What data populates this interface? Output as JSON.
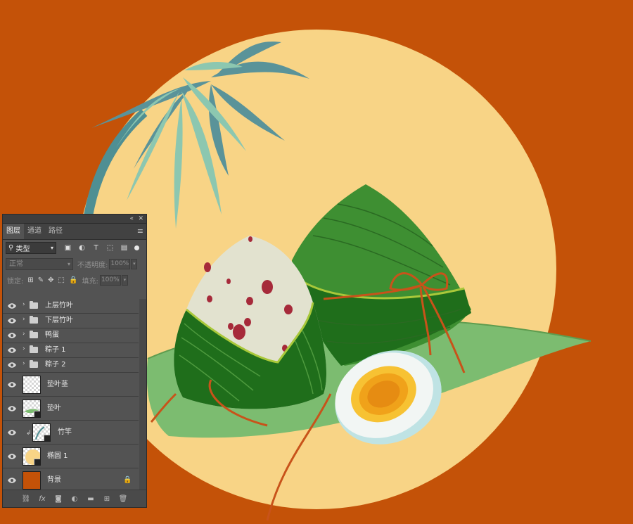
{
  "panel": {
    "collapse_icon": "double-chevron-left",
    "close_icon": "close",
    "tabs": [
      {
        "label": "图层",
        "active": true
      },
      {
        "label": "通道",
        "active": false
      },
      {
        "label": "路径",
        "active": false
      }
    ],
    "filter": {
      "label": "类型"
    },
    "blend_mode": "正常",
    "opacity_label": "不透明度:",
    "opacity_value": "100%",
    "lock_label": "锁定:",
    "fill_label": "填充:",
    "fill_value": "100%",
    "layers": [
      {
        "name": "上层竹叶",
        "kind": "group",
        "visible": true
      },
      {
        "name": "下层竹叶",
        "kind": "group",
        "visible": true
      },
      {
        "name": "鸭蛋",
        "kind": "group",
        "visible": true
      },
      {
        "name": "粽子 1",
        "kind": "group",
        "visible": true
      },
      {
        "name": "粽子 2",
        "kind": "group",
        "visible": true
      },
      {
        "name": "垫叶茎",
        "kind": "layer",
        "visible": true
      },
      {
        "name": "垫叶",
        "kind": "layer",
        "visible": true
      },
      {
        "name": "竹竿",
        "kind": "clipped-layer",
        "visible": true
      },
      {
        "name": "椭圆 1",
        "kind": "shape-layer",
        "visible": true
      },
      {
        "name": "背景",
        "kind": "background",
        "visible": true,
        "locked": true
      }
    ],
    "bottom_icons": [
      "link-icon",
      "fx-icon",
      "mask-icon",
      "adjustment-icon",
      "folder-icon",
      "new-layer-icon",
      "trash-icon"
    ]
  },
  "canvas": {
    "background_color": "#C45208",
    "moon_color": "#F8D486",
    "leaf_plate_color": "#7CBC70",
    "zongzi_wrap_color": "#3E8F32",
    "rice_color": "#E2E2CF",
    "egg_white_color": "#F2F6F4",
    "yolk_color": "#F0A21A",
    "bamboo_leaf_dark": "#5A9399",
    "bamboo_leaf_light": "#8CC7B0",
    "string_color": "#C8531A"
  }
}
